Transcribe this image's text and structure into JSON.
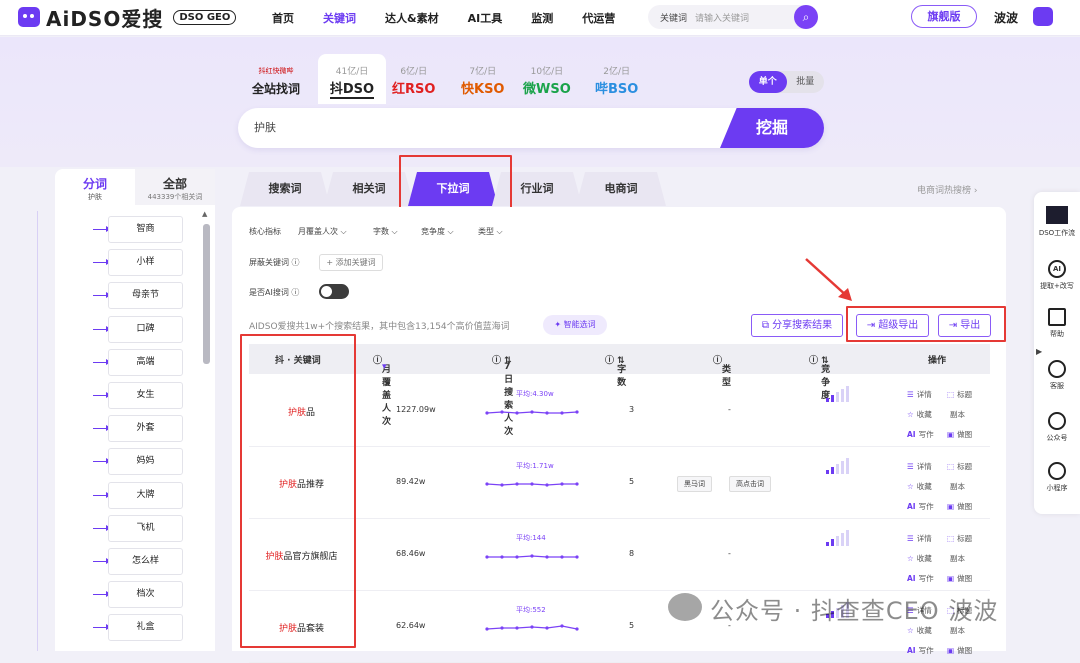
{
  "brand": {
    "logo_text": "AiDSO爱搜",
    "badge": "DSO GEO"
  },
  "nav": {
    "items": [
      "首页",
      "关键词",
      "达人&素材",
      "AI工具",
      "监测",
      "代运营"
    ],
    "active": 1
  },
  "top_search": {
    "select": "关键词",
    "placeholder": "请输入关键词"
  },
  "flagship": "旗舰版",
  "user": "波波",
  "sources": {
    "all": {
      "icons": "抖红快微哔",
      "label": "全站找词"
    },
    "tabs": [
      {
        "count": "41亿/日",
        "label": "抖DSO"
      },
      {
        "count": "6亿/日",
        "label": "红RSO"
      },
      {
        "count": "7亿/日",
        "label": "快KSO"
      },
      {
        "count": "10亿/日",
        "label": "微WSO"
      },
      {
        "count": "2亿/日",
        "label": "哔BSO"
      }
    ]
  },
  "mode": {
    "single": "单个",
    "batch": "批量"
  },
  "search": {
    "value": "护肤",
    "button": "挖掘"
  },
  "left_panel": {
    "tab1": {
      "title": "分词",
      "sub": "护肤"
    },
    "tab2": {
      "title": "全部",
      "sub": "443339个相关词"
    },
    "items": [
      "智商",
      "小样",
      "母亲节",
      "口碑",
      "高端",
      "女生",
      "外套",
      "妈妈",
      "大牌",
      "飞机",
      "怎么样",
      "档次",
      "礼盒"
    ]
  },
  "tabs": [
    "搜索词",
    "相关词",
    "下拉词",
    "行业词",
    "电商词"
  ],
  "active_tab": 2,
  "ecom_link": "电商词热搜榜 ›",
  "filters": {
    "core": "核心指标",
    "monthly": "月覆盖人次",
    "chars": "字数",
    "competition": "竞争度",
    "type": "类型",
    "block": "屏蔽关键词",
    "add": "+ 添加关键词",
    "ai": "是否AI搜词"
  },
  "summary": "AIDSO爱搜共1w+个搜索结果，其中包含13,154个高价值蓝海词",
  "smart": "✦ 智能选词",
  "buttons": {
    "share": "分享搜索结果",
    "super_export": "超级导出",
    "export": "导出"
  },
  "table": {
    "headers": [
      "抖 · 关键词",
      "月覆盖人次",
      "7日搜索人次",
      "字数",
      "类型",
      "竞争度",
      "操作"
    ],
    "rows": [
      {
        "kw_hl": "护肤",
        "kw_rest": "品",
        "monthly": "1227.09w",
        "avg": "平均:4.30w",
        "chars": "3",
        "types": [],
        "type_dash": "-"
      },
      {
        "kw_hl": "护肤",
        "kw_rest": "品推荐",
        "monthly": "89.42w",
        "avg": "平均:1.71w",
        "chars": "5",
        "types": [
          "黑马词",
          "高点击词"
        ],
        "type_dash": ""
      },
      {
        "kw_hl": "护肤",
        "kw_rest": "品官方旗舰店",
        "monthly": "68.46w",
        "avg": "平均:144",
        "chars": "8",
        "types": [],
        "type_dash": "-"
      },
      {
        "kw_hl": "护肤",
        "kw_rest": "品套装",
        "monthly": "62.64w",
        "avg": "平均:552",
        "chars": "5",
        "types": [],
        "type_dash": "-"
      }
    ],
    "ops": [
      "详情",
      "标题",
      "收藏",
      "副本",
      "写作",
      "做图"
    ]
  },
  "right_bar": [
    "DSO工作流",
    "提取+改写",
    "帮助",
    "客服",
    "公众号",
    "小程序"
  ],
  "watermark": "公众号 · 抖查查CEO 波波",
  "colors": {
    "accent": "#6c3bf2",
    "highlight": "#e02020",
    "annotation": "#e53935"
  }
}
